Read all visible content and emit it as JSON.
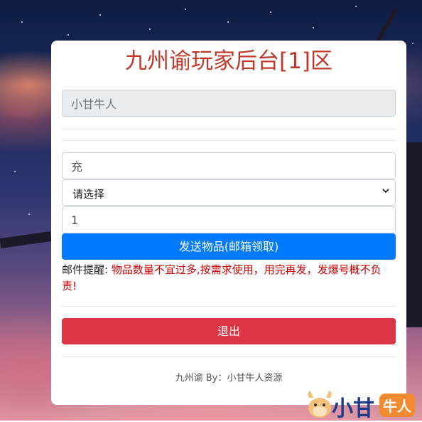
{
  "page": {
    "title": "九州谕玩家后台[1]区"
  },
  "form": {
    "username_value": "小甘牛人",
    "item_value": "充",
    "item_select": {
      "selected": "请选择"
    },
    "quantity_value": "1",
    "send_button_label": "发送物品(邮箱领取)",
    "notice_label": "邮件提醒:",
    "notice_message": "物品数量不宜过多,按需求使用，用完再发，发爆号概不负责!",
    "logout_button_label": "退出"
  },
  "footer": {
    "text": "九州谕 By：小甘牛人资源"
  },
  "watermark": {
    "text_main": "小甘",
    "text_badge": "牛人"
  },
  "colors": {
    "title": "#c0392b",
    "primary_button": "#007bff",
    "danger_button": "#dc3545",
    "notice_message": "#cc0000"
  }
}
